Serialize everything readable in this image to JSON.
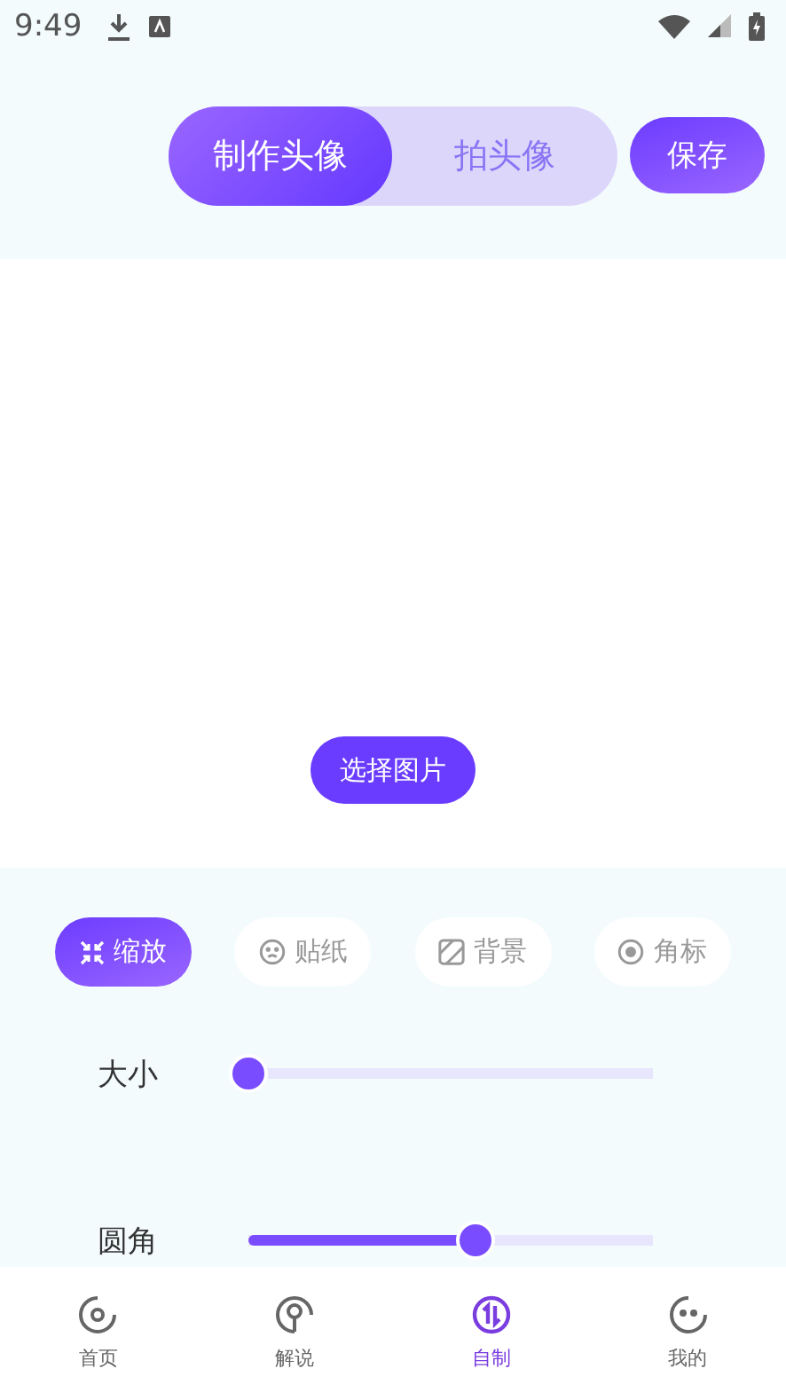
{
  "status_bar": {
    "time": "9:49"
  },
  "mode_tabs": [
    {
      "label": "制作头像",
      "selected": true
    },
    {
      "label": "拍头像",
      "selected": false
    }
  ],
  "save_button": "保存",
  "canvas": {
    "button": "选择图片"
  },
  "tool_tabs": [
    {
      "label": "缩放",
      "selected": true
    },
    {
      "label": "贴纸",
      "selected": false
    },
    {
      "label": "背景",
      "selected": false
    },
    {
      "label": "角标",
      "selected": false
    }
  ],
  "sliders": [
    {
      "label": "大小",
      "level": 0
    },
    {
      "label": "圆角",
      "level": 0.56
    }
  ],
  "nav": [
    {
      "label": "首页",
      "selected": false
    },
    {
      "label": "解说",
      "selected": false
    },
    {
      "label": "自制",
      "selected": true
    },
    {
      "label": "我的",
      "selected": false
    }
  ]
}
